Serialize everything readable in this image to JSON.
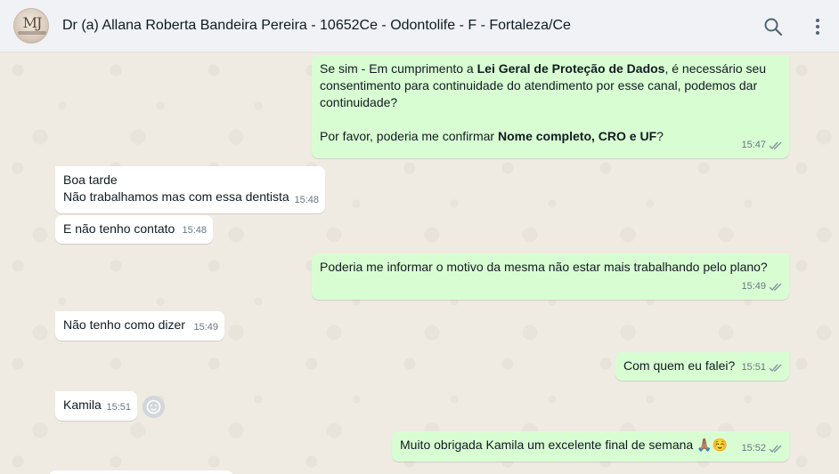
{
  "header": {
    "title": "Dr (a) Allana Roberta Bandeira Pereira - 10652Ce - Odontolife - F - Fortaleza/Ce",
    "avatar_monogram": "MJ",
    "icons": [
      "search-icon",
      "menu-dots-icon"
    ]
  },
  "messages": [
    {
      "direction": "out",
      "paragraph1": {
        "pre": "Se sim - Em cumprimento a ",
        "bold": "Lei Geral de Proteção de Dados",
        "post": ", é necessário seu consentimento para continuidade do atendimento por esse canal, podemos dar continuidade?"
      },
      "paragraph2": {
        "pre": "Por favor, poderia me confirmar ",
        "bold": "Nome completo, CRO e UF",
        "post": "?"
      },
      "time": "15:47",
      "status": "read"
    },
    {
      "direction": "in",
      "line1": "Boa tarde",
      "line2": "Não trabalhamos mas com essa dentista",
      "time": "15:48"
    },
    {
      "direction": "in",
      "text": "E não tenho contato",
      "time": "15:48"
    },
    {
      "direction": "out",
      "text": "Poderia me informar o motivo da mesma não estar mais trabalhando pelo plano?",
      "time": "15:49",
      "status": "read"
    },
    {
      "direction": "in",
      "text": "Não tenho como dizer",
      "time": "15:49"
    },
    {
      "direction": "out",
      "text": "Com quem eu falei?",
      "time": "15:51",
      "status": "read"
    },
    {
      "direction": "in",
      "text": "Kamila",
      "time": "15:51"
    },
    {
      "direction": "out",
      "text": "Muito obrigada Kamila um excelente final de semana 🙏🏽☺️",
      "time": "15:52",
      "status": "read"
    }
  ],
  "colors": {
    "header_bg": "#f0f2f5",
    "chat_bg": "#efeae2",
    "incoming_bubble": "#ffffff",
    "outgoing_bubble": "#d9fdd3",
    "meta_text": "#667781",
    "tick_read": "#53bdeb"
  }
}
